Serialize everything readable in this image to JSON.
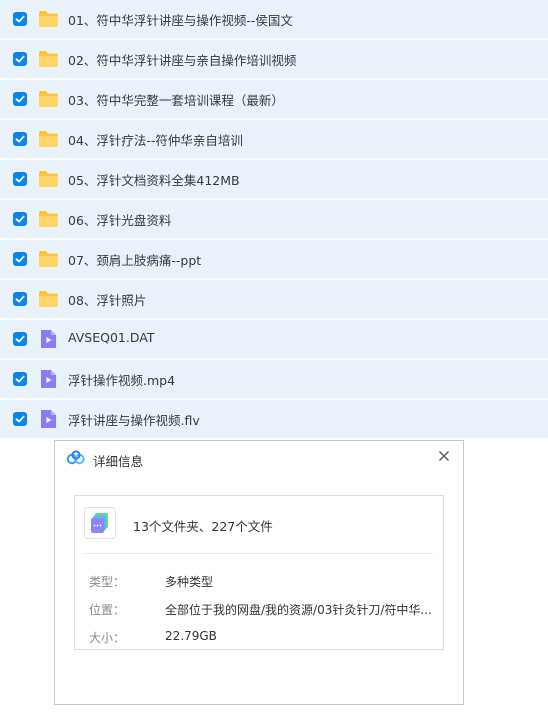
{
  "files": [
    {
      "name": "01、符中华浮针讲座与操作视频--侯国文",
      "type": "folder",
      "checked": true
    },
    {
      "name": "02、符中华浮针讲座与亲自操作培训视频",
      "type": "folder",
      "checked": true
    },
    {
      "name": "03、符中华完整一套培训课程（最新）",
      "type": "folder",
      "checked": true
    },
    {
      "name": "04、浮针疗法--符仲华亲自培训",
      "type": "folder",
      "checked": true
    },
    {
      "name": "05、浮针文档资料全集412MB",
      "type": "folder",
      "checked": true
    },
    {
      "name": "06、浮针光盘资料",
      "type": "folder",
      "checked": true
    },
    {
      "name": "07、颈肩上肢病痛--ppt",
      "type": "folder",
      "checked": true
    },
    {
      "name": "08、浮针照片",
      "type": "folder",
      "checked": true
    },
    {
      "name": "AVSEQ01.DAT",
      "type": "video",
      "checked": true
    },
    {
      "name": "浮针操作视频.mp4",
      "type": "video",
      "checked": true
    },
    {
      "name": "浮针讲座与操作视频.flv",
      "type": "video",
      "checked": true
    }
  ],
  "dialog": {
    "title": "详细信息",
    "summary": "13个文件夹、227个文件",
    "props": [
      {
        "key": "类型：",
        "value": "多种类型"
      },
      {
        "key": "位置：",
        "value": "全部位于我的网盘/我的资源/03针灸针刀/符中华..."
      },
      {
        "key": "大小：",
        "value": "22.79GB"
      }
    ]
  },
  "colors": {
    "row_bg": "#e9f1fb",
    "checkbox": "#0a84f0",
    "folder": "#ffc53d",
    "video_icon": "#8c7bf2"
  }
}
